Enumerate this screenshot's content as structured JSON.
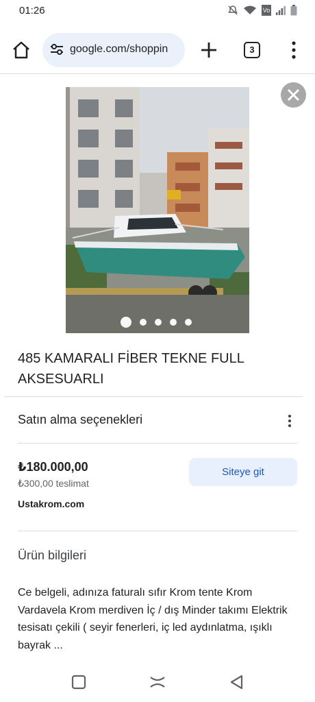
{
  "status_bar": {
    "time": "01:26",
    "icons": [
      "mute-icon",
      "wifi-icon",
      "volte-icon",
      "signal-icon",
      "battery-icon"
    ],
    "volte_text": "Vo"
  },
  "browser": {
    "url": "google.com/shoppin",
    "tab_count": "3"
  },
  "product": {
    "title": "485 KAMARALI FİBER TEKNE FULL AKSESUARLI",
    "image_count": 5,
    "active_image_index": 0
  },
  "purchase": {
    "section_title": "Satın alma seçenekleri",
    "price": "₺180.000,00",
    "shipping": "₺300,00 teslimat",
    "merchant": "Ustakrom.com",
    "visit_button_label": "Siteye git"
  },
  "info": {
    "section_title": "Ürün bilgileri",
    "description": "Ce belgeli, adınıza faturalı sıfır Krom tente Krom Vardavela Krom merdiven İç / dış Minder takımı Elektrik tesisatı çekili ( seyir fenerleri, iç led aydınlatma, ışıklı bayrak ..."
  },
  "colors": {
    "link_blue": "#1a56c8",
    "button_bg": "#e8f0fe",
    "url_bg": "#eaf1fb"
  }
}
